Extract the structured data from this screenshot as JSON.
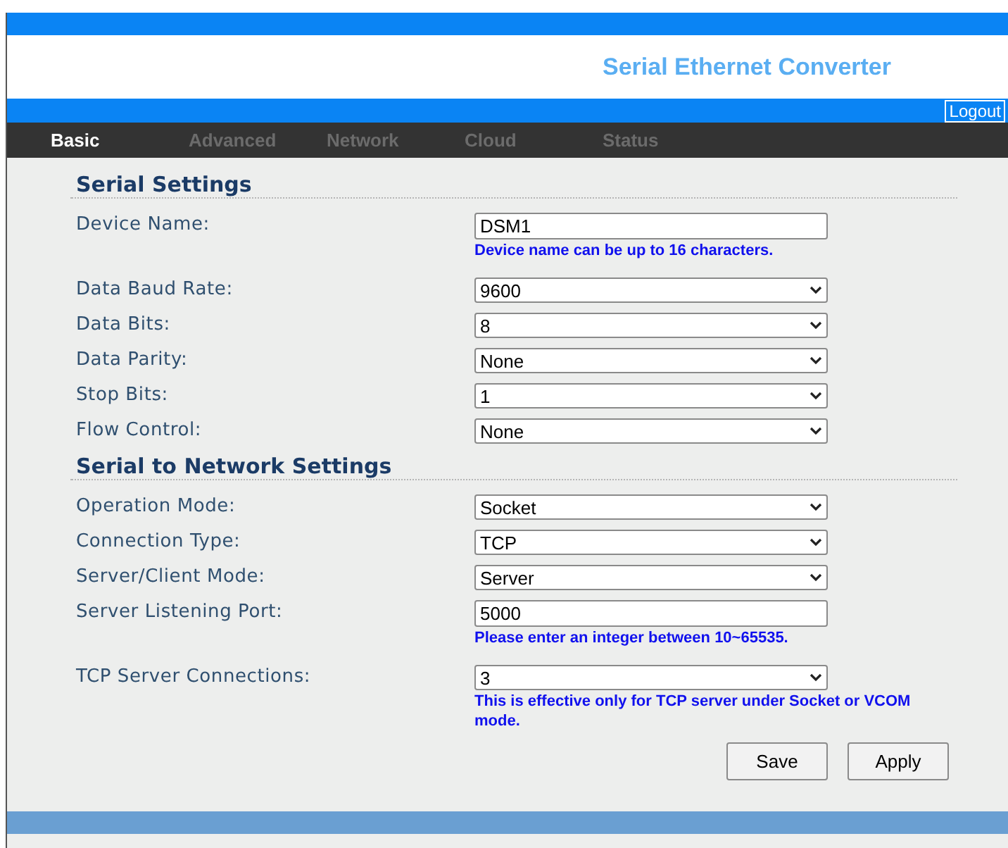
{
  "header": {
    "title": "Serial Ethernet Converter",
    "logout": "Logout"
  },
  "tabs": [
    {
      "label": "Basic",
      "selected": true
    },
    {
      "label": "Advanced",
      "selected": false
    },
    {
      "label": "Network",
      "selected": false
    },
    {
      "label": "Cloud",
      "selected": false
    },
    {
      "label": "Status",
      "selected": false
    }
  ],
  "sections": [
    {
      "title": "Serial Settings",
      "fields": [
        {
          "kind": "text",
          "label": "Device Name:",
          "value": "DSM1",
          "hint": "Device name can be up to 16 characters."
        },
        {
          "kind": "select",
          "label": "Data Baud Rate:",
          "value": "9600"
        },
        {
          "kind": "select",
          "label": "Data Bits:",
          "value": "8"
        },
        {
          "kind": "select",
          "label": "Data Parity:",
          "value": "None"
        },
        {
          "kind": "select",
          "label": "Stop Bits:",
          "value": "1"
        },
        {
          "kind": "select",
          "label": "Flow Control:",
          "value": "None"
        }
      ]
    },
    {
      "title": "Serial to Network Settings",
      "fields": [
        {
          "kind": "select",
          "label": "Operation Mode:",
          "value": "Socket"
        },
        {
          "kind": "select",
          "label": "Connection Type:",
          "value": "TCP"
        },
        {
          "kind": "select",
          "label": "Server/Client Mode:",
          "value": "Server"
        },
        {
          "kind": "text",
          "label": "Server Listening Port:",
          "value": "5000",
          "hint": "Please enter an integer between 10~65535."
        },
        {
          "kind": "select",
          "label": "TCP Server Connections:",
          "value": "3",
          "hint": "This is effective only for TCP server under Socket or VCOM mode."
        }
      ]
    }
  ],
  "buttons": [
    "Save",
    "Apply"
  ]
}
